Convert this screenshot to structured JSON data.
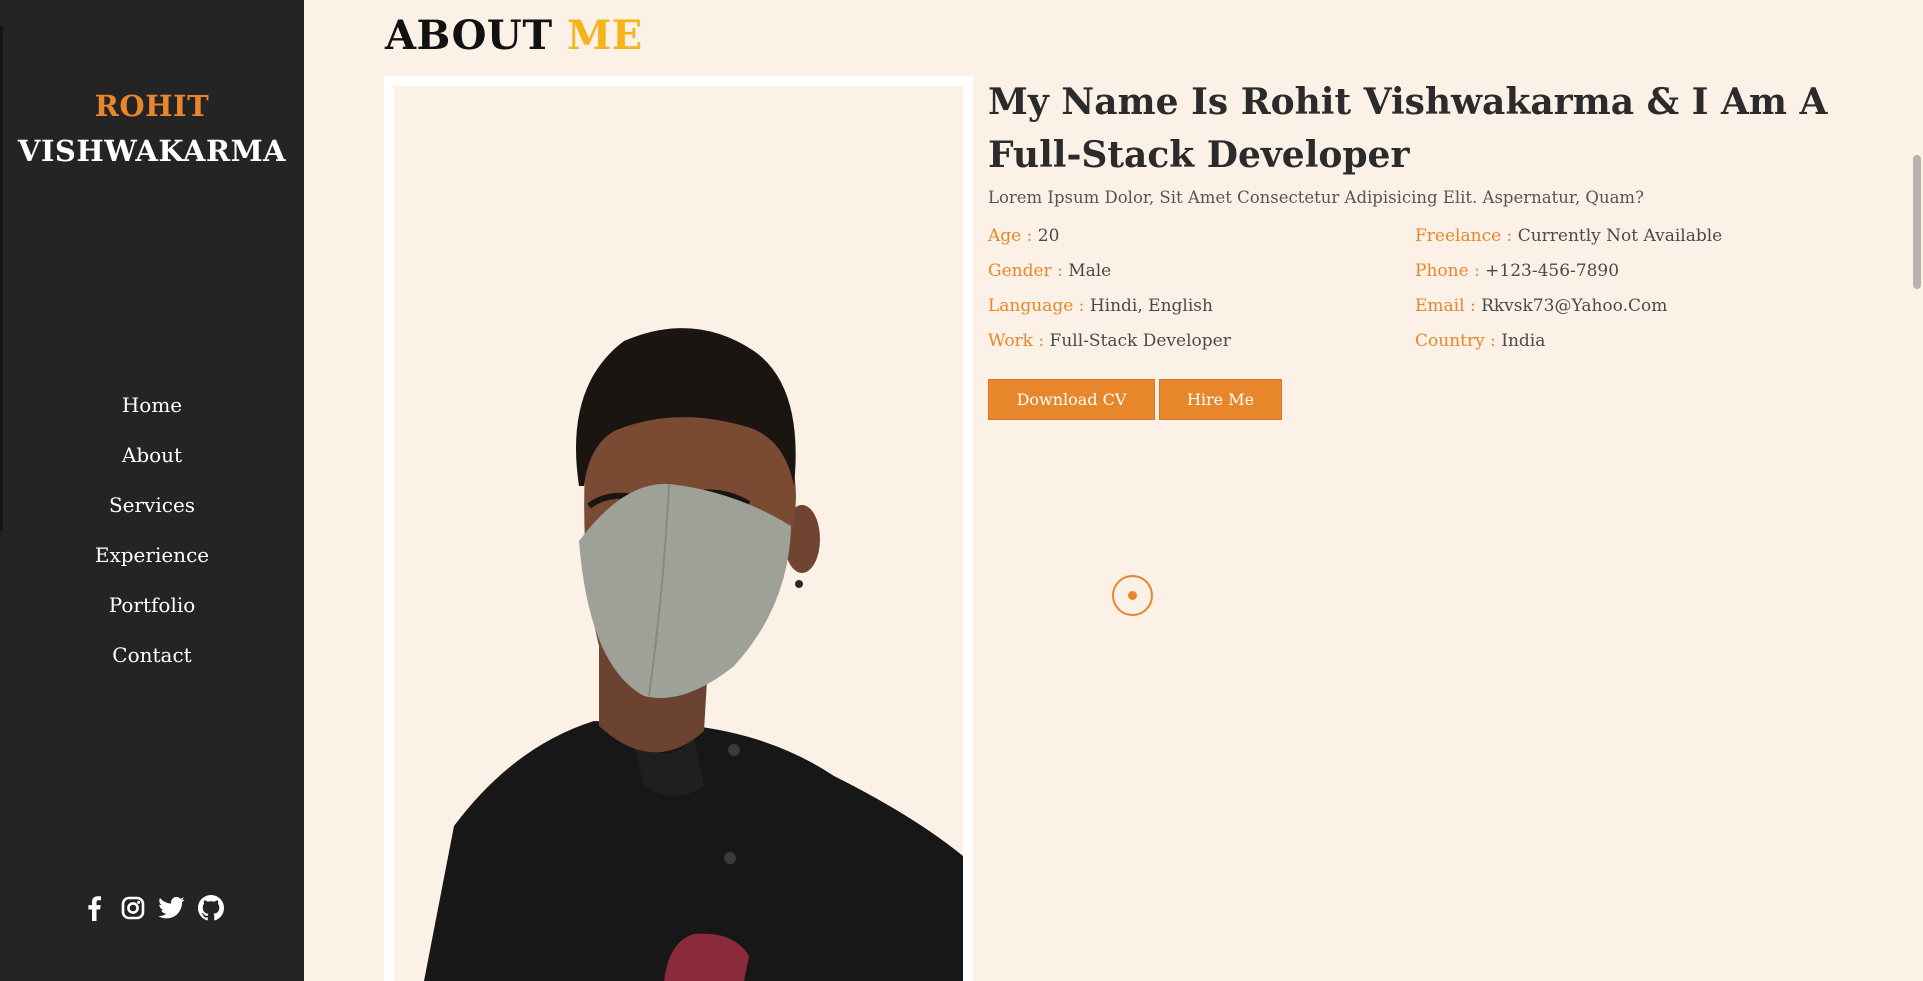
{
  "sidebar": {
    "brand_first": "ROHIT",
    "brand_last": "VISHWAKARMA",
    "nav": [
      {
        "label": "Home"
      },
      {
        "label": "About"
      },
      {
        "label": "Services"
      },
      {
        "label": "Experience"
      },
      {
        "label": "Portfolio"
      },
      {
        "label": "Contact"
      }
    ],
    "socials": [
      "facebook-icon",
      "instagram-icon",
      "twitter-icon",
      "github-icon"
    ]
  },
  "about": {
    "heading_main": "ABOUT",
    "heading_accent": "ME",
    "title": "My Name Is Rohit Vishwakarma & I Am A Full-Stack Developer",
    "text": "Lorem Ipsum Dolor, Sit Amet Consectetur Adipisicing Elit. Aspernatur, Quam?",
    "info": [
      {
        "key": "Age :",
        "value": "20"
      },
      {
        "key": "Freelance :",
        "value": "Currently Not Available"
      },
      {
        "key": "Gender :",
        "value": "Male"
      },
      {
        "key": "Phone :",
        "value": "+123-456-7890"
      },
      {
        "key": "Language :",
        "value": "Hindi, English"
      },
      {
        "key": "Email :",
        "value": "Rkvsk73@Yahoo.Com"
      },
      {
        "key": "Work :",
        "value": "Full-Stack Developer"
      },
      {
        "key": "Country :",
        "value": "India"
      }
    ],
    "buttons": {
      "download": "Download CV",
      "hire": "Hire Me"
    }
  },
  "colors": {
    "accent": "#e7862b",
    "heading_accent": "#f4b41a",
    "sidebar_bg": "#242424",
    "page_bg": "#fbf1e7"
  }
}
